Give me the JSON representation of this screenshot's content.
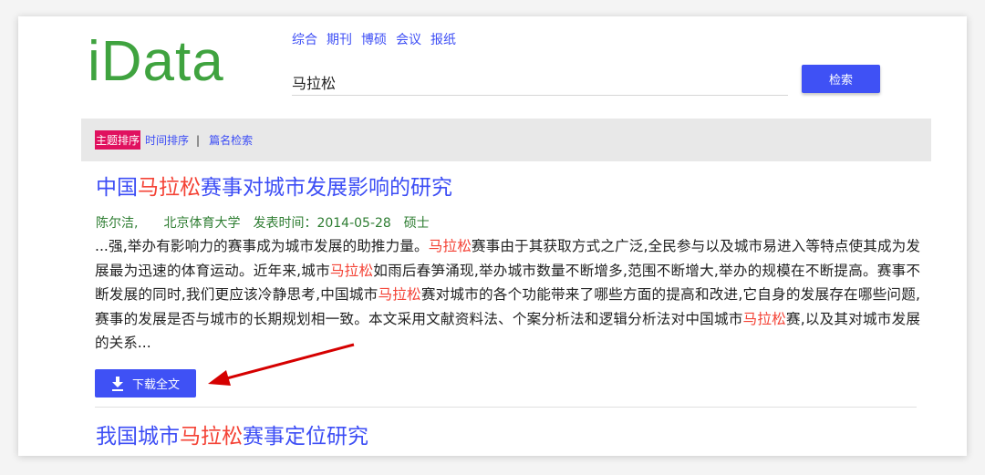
{
  "logo": "iData",
  "nav": [
    "综合",
    "期刊",
    "博硕",
    "会议",
    "报纸"
  ],
  "search": {
    "value": "马拉松",
    "button": "检索"
  },
  "sort": {
    "active": "主题排序",
    "time": "时间排序",
    "sep": "|",
    "title_search": "篇名检索"
  },
  "results": [
    {
      "title": [
        "中国",
        "马拉松",
        "赛事对城市发展影响的研究"
      ],
      "meta": "陈尔洁,　　北京体育大学　发表时间：2014-05-28　硕士",
      "abstract": [
        "...强,举办有影响力的赛事成为城市发展的助推力量。",
        "马拉松",
        "赛事由于其获取方式之广泛,全民参与以及城市易进入等特点使其成为发展最为迅速的体育运动。近年来,城市",
        "马拉松",
        "如雨后春笋涌现,举办城市数量不断增多,范围不断增大,举办的规模在不断提高。赛事不断发展的同时,我们更应该冷静思考,中国城市",
        "马拉松",
        "赛对城市的各个功能带来了哪些方面的提高和改进,它自身的发展存在哪些问题,赛事的发展是否与城市的长期规划相一致。本文采用文献资料法、个案分析法和逻辑分析法对中国城市",
        "马拉松",
        "赛,以及其对城市发展的关系..."
      ],
      "download": "下载全文"
    },
    {
      "title": [
        "我国城市",
        "马拉松",
        "赛事定位研究"
      ]
    }
  ],
  "colors": {
    "accent": "#3f51f5",
    "highlight": "#f44336",
    "logo": "#3fa33f",
    "active_sort": "#e0115f",
    "annotation": "#d50000"
  }
}
